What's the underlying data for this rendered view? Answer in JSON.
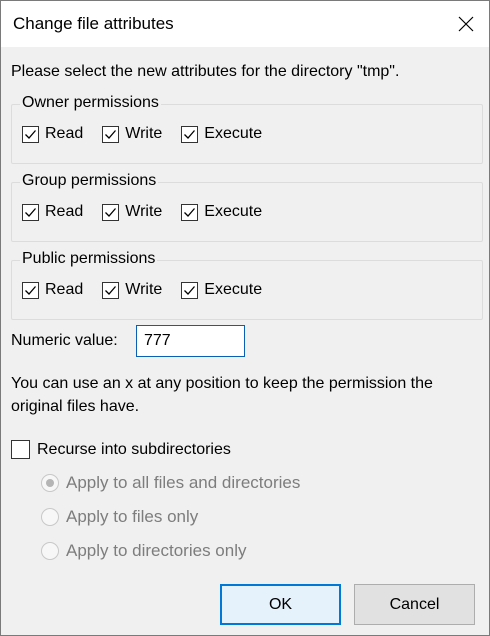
{
  "dialog": {
    "title": "Change file attributes",
    "instruction": "Please select the new attributes for the directory \"tmp\"."
  },
  "groups": [
    {
      "legend": "Owner permissions",
      "read": "Read",
      "write": "Write",
      "execute": "Execute",
      "checked": [
        true,
        true,
        true
      ]
    },
    {
      "legend": "Group permissions",
      "read": "Read",
      "write": "Write",
      "execute": "Execute",
      "checked": [
        true,
        true,
        true
      ]
    },
    {
      "legend": "Public permissions",
      "read": "Read",
      "write": "Write",
      "execute": "Execute",
      "checked": [
        true,
        true,
        true
      ]
    }
  ],
  "numeric": {
    "label": "Numeric value:",
    "value": "777"
  },
  "hint": "You can use an x at any position to keep the permission the original files have.",
  "recurse": {
    "label": "Recurse into subdirectories",
    "checked": false,
    "options": [
      {
        "label": "Apply to all files and directories",
        "selected": true
      },
      {
        "label": "Apply to files only",
        "selected": false
      },
      {
        "label": "Apply to directories only",
        "selected": false
      }
    ]
  },
  "buttons": {
    "ok": "OK",
    "cancel": "Cancel"
  },
  "icons": {
    "close": "close-icon",
    "check": "checkmark-icon"
  },
  "colors": {
    "accent": "#0078d7",
    "dialog_bg": "#f0f0f0"
  }
}
